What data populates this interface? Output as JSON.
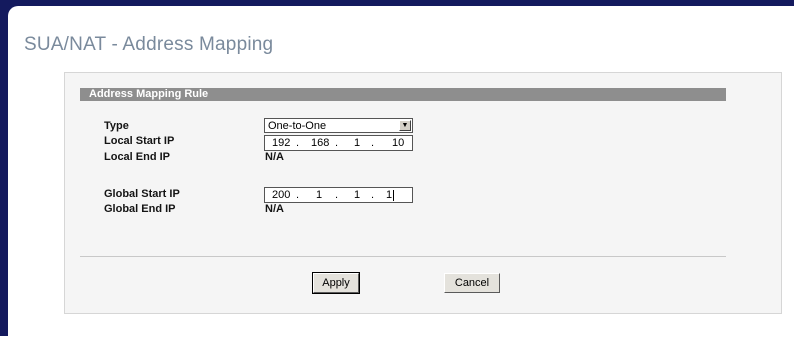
{
  "page": {
    "title": "SUA/NAT - Address Mapping"
  },
  "section": {
    "title": "Address Mapping Rule"
  },
  "fields": {
    "type": {
      "label": "Type",
      "value": "One-to-One"
    },
    "local_start_ip": {
      "label": "Local Start IP",
      "octets": [
        "192",
        "168",
        "1",
        "10"
      ]
    },
    "local_end_ip": {
      "label": "Local End IP",
      "value": "N/A"
    },
    "global_start_ip": {
      "label": "Global Start IP",
      "octets": [
        "200",
        "1",
        "1",
        "1"
      ]
    },
    "global_end_ip": {
      "label": "Global End IP",
      "value": "N/A"
    }
  },
  "separator": ".",
  "buttons": {
    "apply": "Apply",
    "cancel": "Cancel"
  },
  "colors": {
    "frame": "#141a5e",
    "title": "#7a8a9c",
    "section_bar": "#8e8e8e"
  },
  "icons": {
    "dropdown": "chevron-down-icon"
  }
}
